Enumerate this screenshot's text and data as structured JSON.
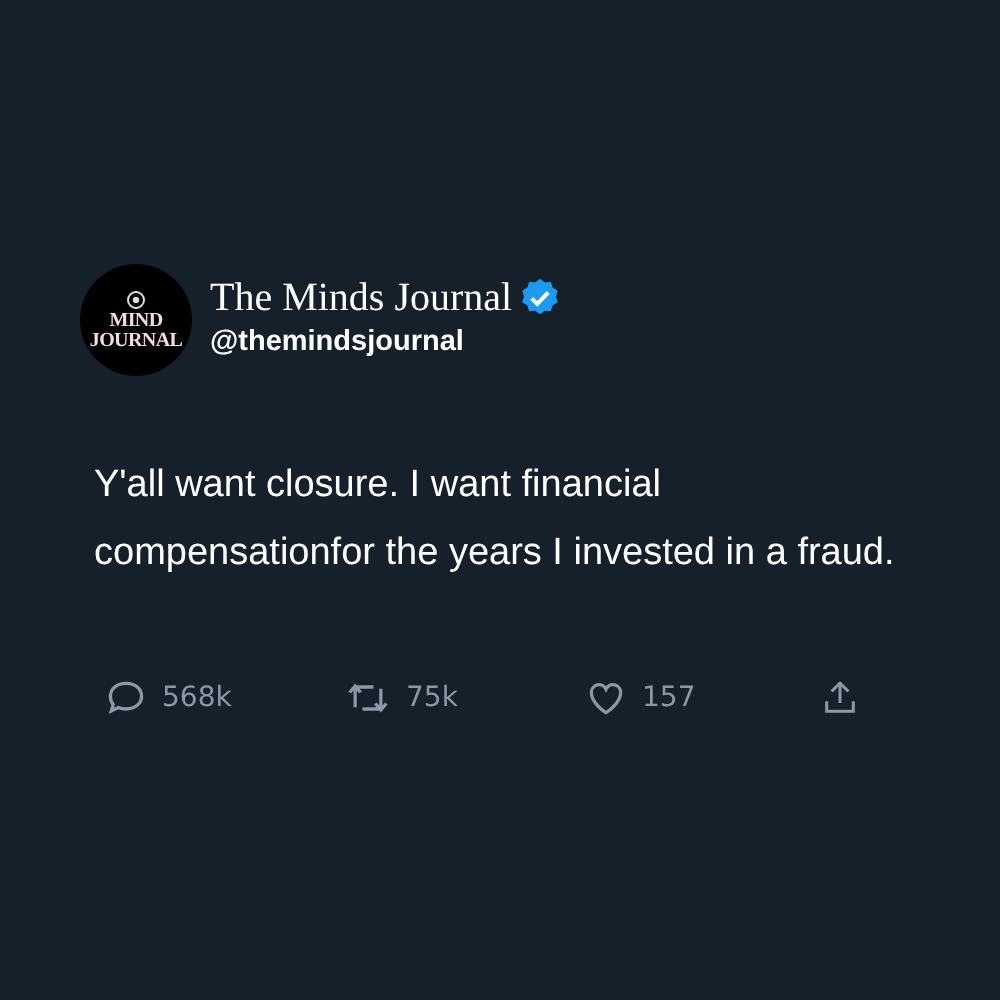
{
  "author": {
    "logo_lines": [
      "MIND",
      "JOURNAL"
    ],
    "name": "The Minds Journal",
    "verified": true,
    "handle": "@themindsjournal"
  },
  "text_lines": [
    "Y'all want closure. I want financial",
    "compensationfor the years I invested in a fraud."
  ],
  "actions": [
    {
      "kind": "reply",
      "count": "568k"
    },
    {
      "kind": "retweet",
      "count": "75k"
    },
    {
      "kind": "like",
      "count": "157"
    },
    {
      "kind": "share"
    }
  ]
}
